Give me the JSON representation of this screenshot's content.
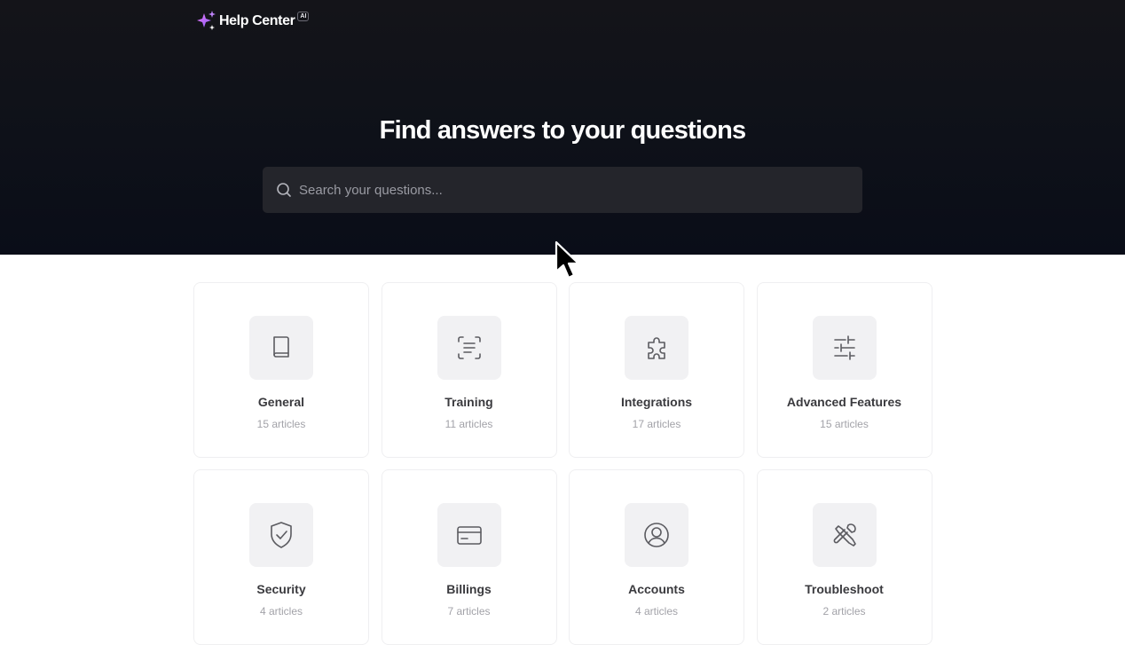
{
  "brand": {
    "name": "Help Center",
    "badge": "AI",
    "icon": "sparkles-icon",
    "accent": "#a855f7"
  },
  "hero": {
    "title": "Find answers to your questions",
    "search": {
      "placeholder": "Search your questions...",
      "value": "",
      "icon": "search-icon"
    }
  },
  "categories": [
    {
      "title": "General",
      "count": "15 articles",
      "icon": "book-icon"
    },
    {
      "title": "Training",
      "count": "11 articles",
      "icon": "text-scan-icon"
    },
    {
      "title": "Integrations",
      "count": "17 articles",
      "icon": "puzzle-icon"
    },
    {
      "title": "Advanced Features",
      "count": "15 articles",
      "icon": "sliders-icon"
    },
    {
      "title": "Security",
      "count": "4 articles",
      "icon": "shield-check-icon"
    },
    {
      "title": "Billings",
      "count": "7 articles",
      "icon": "credit-card-icon"
    },
    {
      "title": "Accounts",
      "count": "4 articles",
      "icon": "user-circle-icon"
    },
    {
      "title": "Troubleshoot",
      "count": "2 articles",
      "icon": "tools-icon"
    }
  ],
  "colors": {
    "hero_bg": "#0e1119",
    "search_bg": "#24252b",
    "card_icon_bg": "#f1f1f3",
    "title_text": "#3a3a3e",
    "count_text": "#a2a2a8"
  }
}
